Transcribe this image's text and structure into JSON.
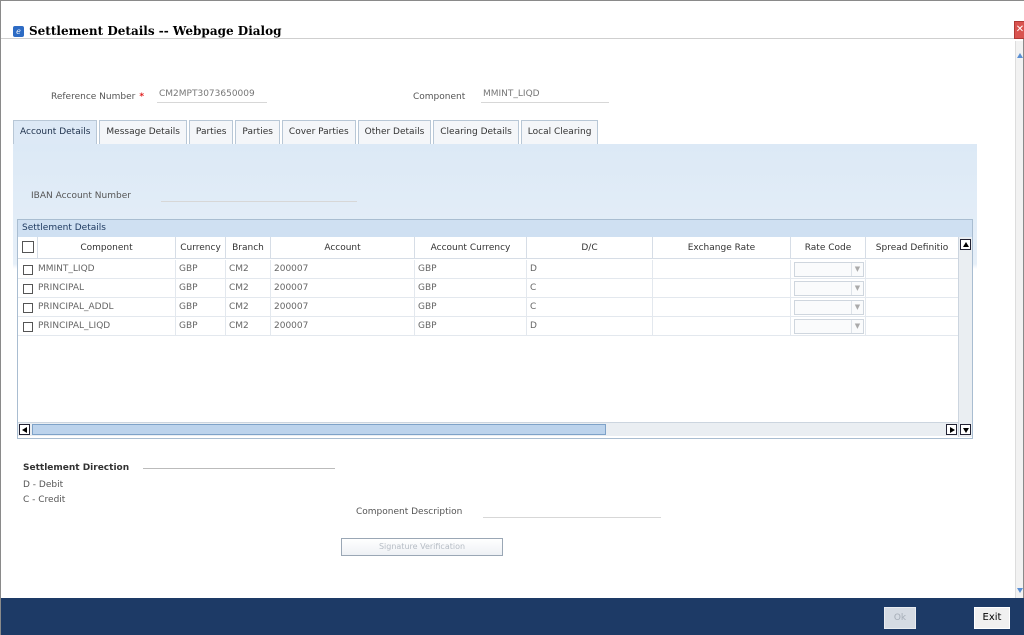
{
  "window": {
    "title": "Settlement Details -- Webpage Dialog"
  },
  "header": {
    "reference_label": "Reference Number",
    "reference_required": "*",
    "reference_value": "CM2MPT3073650009",
    "component_label": "Component",
    "component_value": "MMINT_LIQD"
  },
  "tabs": [
    {
      "label": "Account Details",
      "active": true
    },
    {
      "label": "Message Details"
    },
    {
      "label": "Parties"
    },
    {
      "label": "Parties"
    },
    {
      "label": "Cover Parties"
    },
    {
      "label": "Other Details"
    },
    {
      "label": "Clearing Details"
    },
    {
      "label": "Local Clearing"
    }
  ],
  "iban": {
    "label": "IBAN Account Number",
    "value": ""
  },
  "grid": {
    "title": "Settlement Details",
    "columns": [
      "Component",
      "Currency",
      "Branch",
      "Account",
      "Account Currency",
      "D/C",
      "Exchange Rate",
      "Rate Code",
      "Spread Definitio"
    ],
    "rows": [
      {
        "component": "MMINT_LIQD",
        "currency": "GBP",
        "branch": "CM2",
        "account": "200007",
        "account_currency": "GBP",
        "dc": "D"
      },
      {
        "component": "PRINCIPAL",
        "currency": "GBP",
        "branch": "CM2",
        "account": "200007",
        "account_currency": "GBP",
        "dc": "C"
      },
      {
        "component": "PRINCIPAL_ADDL",
        "currency": "GBP",
        "branch": "CM2",
        "account": "200007",
        "account_currency": "GBP",
        "dc": "C"
      },
      {
        "component": "PRINCIPAL_LIQD",
        "currency": "GBP",
        "branch": "CM2",
        "account": "200007",
        "account_currency": "GBP",
        "dc": "D"
      }
    ]
  },
  "settlement_direction": {
    "title": "Settlement Direction",
    "debit": "D - Debit",
    "credit": "C - Credit"
  },
  "component_description": {
    "label": "Component Description",
    "value": ""
  },
  "buttons": {
    "signature_verification": "Signature Verification",
    "ok": "Ok",
    "exit": "Exit"
  },
  "colors": {
    "footer": "#1d3a66",
    "tab_active": "#dde9f6",
    "required": "#e02020"
  },
  "icons": {
    "title_icon": "ie-page-icon",
    "close": "close-icon"
  }
}
